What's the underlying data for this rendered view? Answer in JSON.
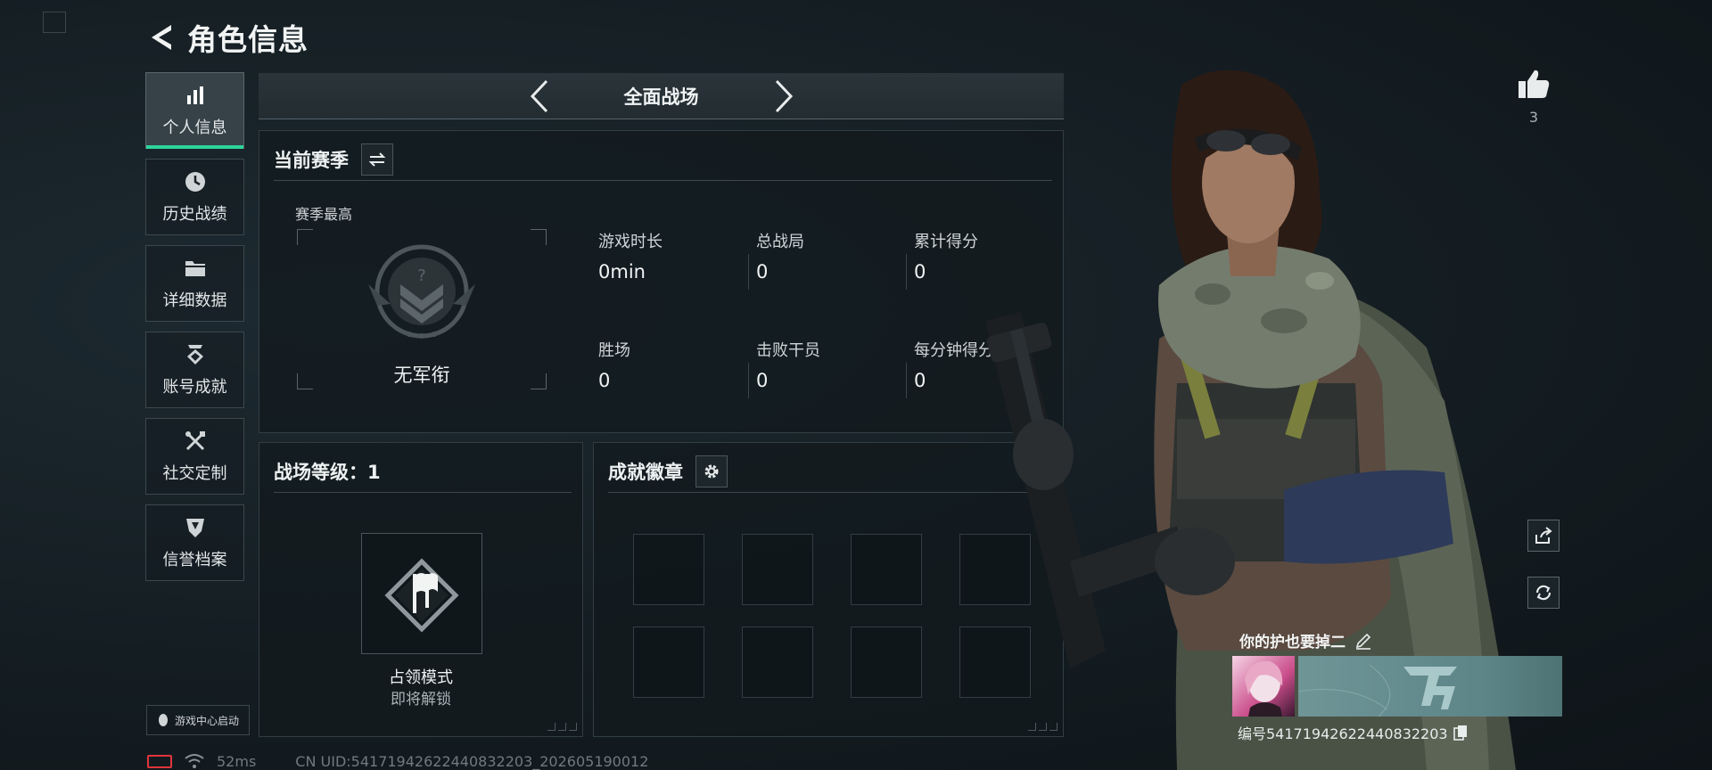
{
  "header": {
    "title": "角色信息"
  },
  "sidebar": {
    "items": [
      {
        "label": "个人信息",
        "icon": "bar-chart-icon",
        "active": true
      },
      {
        "label": "历史战绩",
        "icon": "clock-icon",
        "active": false
      },
      {
        "label": "详细数据",
        "icon": "folder-icon",
        "active": false
      },
      {
        "label": "账号成就",
        "icon": "achievement-icon",
        "active": false
      },
      {
        "label": "社交定制",
        "icon": "tools-icon",
        "active": false
      },
      {
        "label": "信誉档案",
        "icon": "shield-icon",
        "active": false
      }
    ],
    "launch_label": "游戏中心启动"
  },
  "mode_selector": {
    "title": "全面战场"
  },
  "season": {
    "title": "当前赛季",
    "rank_caption": "赛季最高",
    "rank_name": "无军衔",
    "stats": [
      {
        "label": "游戏时长",
        "value": "0min"
      },
      {
        "label": "总战局",
        "value": "0"
      },
      {
        "label": "累计得分",
        "value": "0"
      },
      {
        "label": "胜场",
        "value": "0"
      },
      {
        "label": "击败干员",
        "value": "0"
      },
      {
        "label": "每分钟得分",
        "value": "0"
      }
    ]
  },
  "battlefield_level": {
    "title": "战场等级：1",
    "mode_name": "占领模式",
    "mode_status": "即将解锁"
  },
  "achievements": {
    "title": "成就徽章"
  },
  "profile": {
    "likes": "3",
    "player_name": "你的护也要掉二",
    "player_id": "编号54171942622440832203"
  },
  "status_bar": {
    "ping": "52ms",
    "uid": "CN UID:54171942622440832203_202605190012"
  },
  "colors": {
    "accent": "#2fd39a",
    "battery": "#e0353a"
  }
}
